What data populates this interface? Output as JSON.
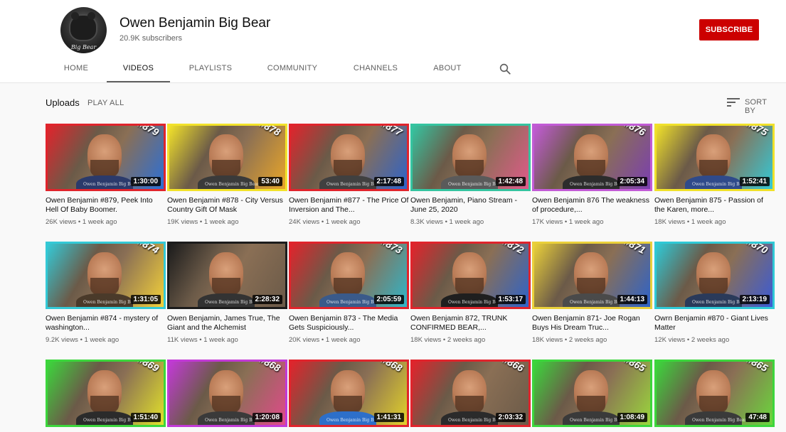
{
  "channel": {
    "name": "Owen Benjamin Big Bear",
    "subscribers": "20.9K subscribers",
    "avatar_text": "Big Bear",
    "subscribe_label": "SUBSCRIBE"
  },
  "tabs": [
    "HOME",
    "VIDEOS",
    "PLAYLISTS",
    "COMMUNITY",
    "CHANNELS",
    "ABOUT"
  ],
  "active_tab": "VIDEOS",
  "section": {
    "title": "Uploads",
    "play_all": "PLAY ALL",
    "sort_label": "SORT BY"
  },
  "watermark": "Owen Benjamin Big Bear",
  "colors": {
    "subscribe": "#cc0000",
    "text_primary": "#0f0f0f",
    "text_secondary": "#606060"
  },
  "videos": [
    {
      "number": "#879",
      "duration": "1:30:00",
      "title": "Owen Benjamin #879, Peek Into Hell Of Baby Boomer.",
      "meta": "26K views • 1 week ago",
      "c1": "#e0242c",
      "c2": "#2c6fd6",
      "shirt": "#2b3a6b"
    },
    {
      "number": "#878",
      "duration": "53:40",
      "title": "Owen Benjamin #878 - City Versus Country Gift Of Mask",
      "meta": "19K views • 1 week ago",
      "c1": "#f2e22a",
      "c2": "#e9a628",
      "shirt": "#3a3a3a"
    },
    {
      "number": "#877",
      "duration": "2:17:48",
      "title": "Owen Benjamin #877 - The Price Of Inversion and The...",
      "meta": "24K views • 1 week ago",
      "c1": "#e0242c",
      "c2": "#2e63c9",
      "shirt": "#404040"
    },
    {
      "number": "",
      "duration": "1:42:48",
      "title": "Owen Benjamin, Piano Stream - June 25, 2020",
      "meta": "8.3K views • 1 week ago",
      "c1": "#35c4a0",
      "c2": "#e05a8a",
      "shirt": "#5a5a5a"
    },
    {
      "number": "#876",
      "duration": "2:05:34",
      "title": "Owen Benjamin 876 The weakness of procedure,...",
      "meta": "17K views • 1 week ago",
      "c1": "#c25bd6",
      "c2": "#7b3fb0",
      "shirt": "#2c2c2c"
    },
    {
      "number": "#875",
      "duration": "1:52:41",
      "title": "Owen Benjamin 875 - Passion of the Karen, more...",
      "meta": "18K views • 1 week ago",
      "c1": "#f0e12a",
      "c2": "#33c9d6",
      "shirt": "#2f4a8a"
    },
    {
      "number": "#874",
      "duration": "1:31:05",
      "title": "Owen Benjamin #874 - mystery of washington...",
      "meta": "9.2K views • 1 week ago",
      "c1": "#34c9d6",
      "c2": "#f3d13a",
      "shirt": "#4a3a2a"
    },
    {
      "number": "",
      "duration": "2:28:32",
      "title": "Owen Benjamin, James True, The Giant and the Alchemist",
      "meta": "11K views • 1 week ago",
      "c1": "#1c1c1c",
      "c2": "#6b5a48",
      "shirt": "#333333"
    },
    {
      "number": "#873",
      "duration": "2:05:59",
      "title": "Owen Benjamin 873 - The Media Gets Suspiciously...",
      "meta": "20K views • 1 week ago",
      "c1": "#e0242c",
      "c2": "#2fb6c9",
      "shirt": "#3a5a8a"
    },
    {
      "number": "#872",
      "duration": "1:53:17",
      "title": "Owen Benjamin 872, TRUNK CONFIRMED BEAR,...",
      "meta": "18K views • 2 weeks ago",
      "c1": "#e0242c",
      "c2": "#2e63c9",
      "shirt": "#1f1f1f"
    },
    {
      "number": "#871",
      "duration": "1:44:13",
      "title": "Owen Benjamin 871- Joe Rogan Buys His Dream Truc...",
      "meta": "18K views • 2 weeks ago",
      "c1": "#ead03a",
      "c2": "#2e63c9",
      "shirt": "#4a4a4a"
    },
    {
      "number": "#870",
      "duration": "2:13:19",
      "title": "Owrn Benjamin #870 - Giant Lives Matter",
      "meta": "12K views • 2 weeks ago",
      "c1": "#2fc9d6",
      "c2": "#3b5bd6",
      "shirt": "#2a3a5a"
    },
    {
      "number": "#869",
      "duration": "1:51:40",
      "title": "",
      "meta": "",
      "c1": "#3cd63c",
      "c2": "#e2e22a",
      "shirt": "#2b2b2b"
    },
    {
      "number": "#868",
      "duration": "1:20:08",
      "title": "",
      "meta": "",
      "c1": "#c23ad6",
      "c2": "#e04a8a",
      "shirt": "#3a3a3a"
    },
    {
      "number": "#868",
      "duration": "1:41:31",
      "title": "",
      "meta": "",
      "c1": "#e0242c",
      "c2": "#e2d22a",
      "shirt": "#2d6fc9"
    },
    {
      "number": "#866",
      "duration": "2:03:32",
      "title": "",
      "meta": "",
      "c1": "#e0242c",
      "c2": "#6b5a48",
      "shirt": "#2b2b2b"
    },
    {
      "number": "#865",
      "duration": "1:08:49",
      "title": "",
      "meta": "",
      "c1": "#3cd63c",
      "c2": "#9ad63c",
      "shirt": "#3a3a3a"
    },
    {
      "number": "#865",
      "duration": "47:48",
      "title": "",
      "meta": "",
      "c1": "#3cd63c",
      "c2": "#6bd63c",
      "shirt": "#3a3a3a"
    }
  ]
}
